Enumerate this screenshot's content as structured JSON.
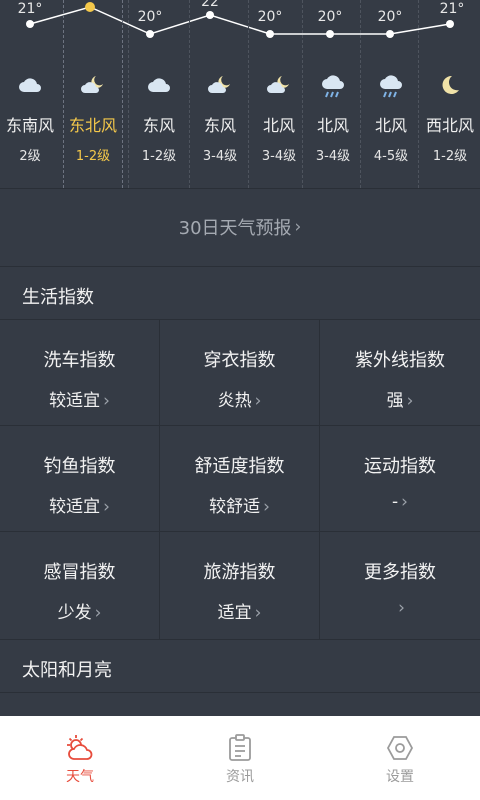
{
  "forecast": {
    "temperatures": [
      "21°",
      "",
      "20°",
      "22",
      "20°",
      "20°",
      "20°",
      "21°"
    ],
    "days": [
      {
        "icon": "cloud-icon",
        "wind": "东南风",
        "level": "2级"
      },
      {
        "icon": "partly-cloudy-night-icon",
        "wind": "东北风",
        "level": "1-2级"
      },
      {
        "icon": "cloud-icon",
        "wind": "东风",
        "level": "1-2级"
      },
      {
        "icon": "partly-cloudy-night-icon",
        "wind": "东风",
        "level": "3-4级"
      },
      {
        "icon": "partly-cloudy-night-icon",
        "wind": "北风",
        "level": "3-4级"
      },
      {
        "icon": "rain-cloud-icon",
        "wind": "北风",
        "level": "3-4级"
      },
      {
        "icon": "rain-cloud-icon",
        "wind": "北风",
        "level": "4-5级"
      },
      {
        "icon": "moon-icon",
        "wind": "西北风",
        "level": "1-2级"
      }
    ],
    "selected_index": 1,
    "line_color": "#ffffff",
    "highlight_color": "#f4c84a"
  },
  "forecast30": {
    "label": "30日天气预报"
  },
  "life_index": {
    "title": "生活指数",
    "items": [
      {
        "name": "洗车指数",
        "value": "较适宜"
      },
      {
        "name": "穿衣指数",
        "value": "炎热"
      },
      {
        "name": "紫外线指数",
        "value": "强"
      },
      {
        "name": "钓鱼指数",
        "value": "较适宜"
      },
      {
        "name": "舒适度指数",
        "value": "较舒适"
      },
      {
        "name": "运动指数",
        "value": "-"
      },
      {
        "name": "感冒指数",
        "value": "少发"
      },
      {
        "name": "旅游指数",
        "value": "适宜"
      },
      {
        "name": "更多指数",
        "value": ""
      }
    ]
  },
  "sun_moon": {
    "title": "太阳和月亮"
  },
  "tabbar": {
    "tabs": [
      {
        "label": "天气",
        "icon": "weather-icon",
        "active": true
      },
      {
        "label": "资讯",
        "icon": "news-icon",
        "active": false
      },
      {
        "label": "设置",
        "icon": "settings-icon",
        "active": false
      }
    ],
    "active_color": "#e74c3c"
  }
}
